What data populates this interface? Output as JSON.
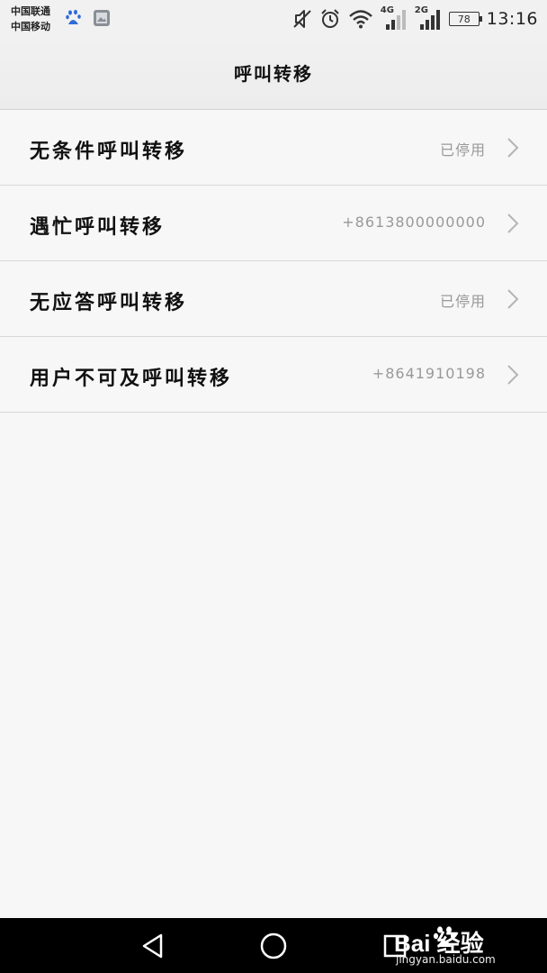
{
  "status_bar": {
    "carrier_1": "中国联通",
    "carrier_2": "中国移动",
    "app_icons": [
      "baidu-paw-icon",
      "gallery-icon"
    ],
    "indicators": [
      "mute-icon",
      "alarm-icon",
      "wifi-icon",
      "signal-4g-icon",
      "signal-2g-icon"
    ],
    "network_1": "4G",
    "network_2": "2G",
    "battery": "78",
    "time": "13:16"
  },
  "header": {
    "title": "呼叫转移"
  },
  "settings": [
    {
      "label": "无条件呼叫转移",
      "value": "已停用"
    },
    {
      "label": "遇忙呼叫转移",
      "value": "+8613800000000"
    },
    {
      "label": "无应答呼叫转移",
      "value": "已停用"
    },
    {
      "label": "用户不可及呼叫转移",
      "value": "+8641910198"
    }
  ],
  "nav_bar": {
    "buttons": [
      "back-icon",
      "home-icon",
      "recents-icon"
    ]
  },
  "watermark": {
    "brand": "Bai 经验",
    "url": "jingyan.baidu.com"
  },
  "colors": {
    "background": "#f7f7f7",
    "header": "#f1f1f1",
    "divider": "#d8d8d8",
    "value_text": "#999999",
    "nav_bar": "#000000"
  }
}
